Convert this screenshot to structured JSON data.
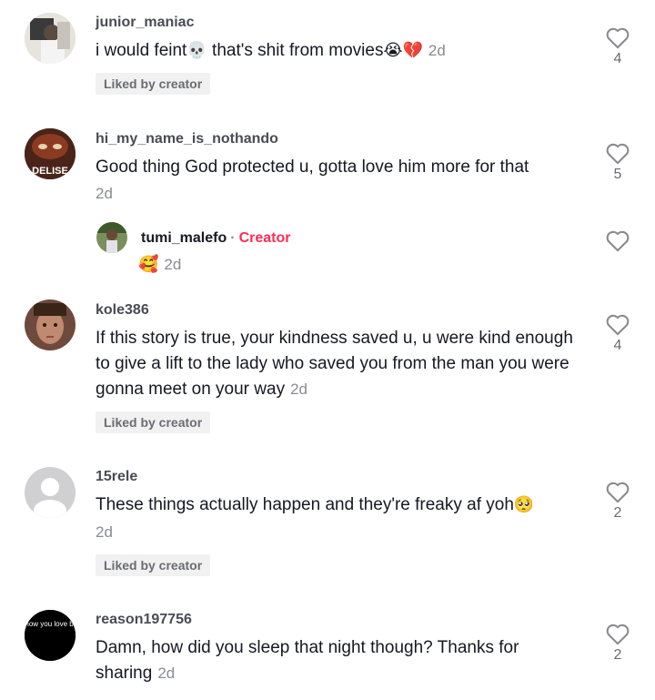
{
  "comments": [
    {
      "username": "junior_maniac",
      "text_a": "i would feint",
      "emoji_a": "💀",
      "text_b": " that's shit from movies",
      "emoji_b": "😭💔",
      "time": "2d",
      "badge": "Liked by creator",
      "likes": "4"
    },
    {
      "username": "hi_my_name_is_nothando",
      "text": "Good thing God protected u, gotta love him more for that",
      "time": "2d",
      "likes": "5",
      "avatar_text": "DELISE"
    },
    {
      "username": "tumi_malefo",
      "creator_tag": "Creator",
      "emoji": "🥰",
      "time": "2d"
    },
    {
      "username": "kole386",
      "text": "If this story is true, your kindness saved u, u were kind enough to give a lift to the lady who saved you from the man you were gonna meet on your way",
      "time": "2d",
      "badge": "Liked by creator",
      "likes": "4"
    },
    {
      "username": "15rele",
      "text": "These things actually happen and they're freaky af yoh",
      "emoji": "🥺",
      "time": "2d",
      "badge": "Liked by creator",
      "likes": "2"
    },
    {
      "username": "reason197756",
      "text": "Damn, how did you sleep that night though? Thanks for sharing",
      "time": "2d",
      "likes": "2",
      "avatar_text": "You don't know you love be gives bea"
    }
  ],
  "icons": {
    "like": "heart-outline-icon",
    "reply_separator": "·"
  },
  "colors": {
    "creator": "#fe2c55",
    "badge_bg": "#f1f1f2"
  }
}
